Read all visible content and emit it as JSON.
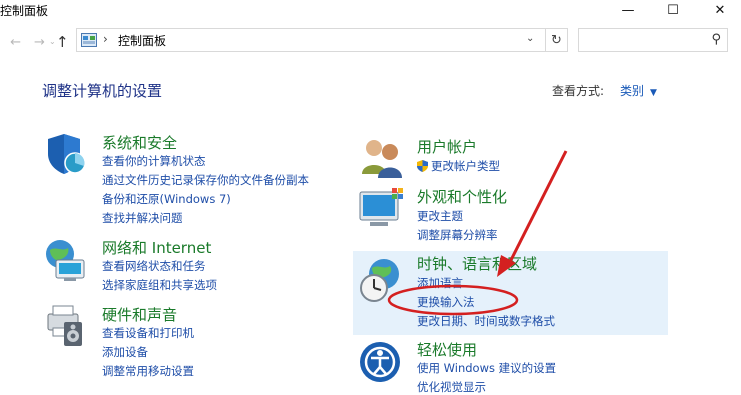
{
  "window": {
    "title": "控制面板",
    "min_icon": "—",
    "max_icon": "☐",
    "close_icon": "✕"
  },
  "nav": {
    "back": "→",
    "forward": "→",
    "up": "↑",
    "breadcrumb": "控制面板",
    "refresh": "↻",
    "search_placeholder": ""
  },
  "header": {
    "title": "调整计算机的设置",
    "view_by_label": "查看方式:",
    "view_by_value": "类别"
  },
  "categories": {
    "system": {
      "title": "系统和安全",
      "links": [
        "查看你的计算机状态",
        "通过文件历史记录保存你的文件备份副本",
        "备份和还原(Windows 7)",
        "查找并解决问题"
      ]
    },
    "network": {
      "title": "网络和 Internet",
      "links": [
        "查看网络状态和任务",
        "选择家庭组和共享选项"
      ]
    },
    "hardware": {
      "title": "硬件和声音",
      "links": [
        "查看设备和打印机",
        "添加设备",
        "调整常用移动设置"
      ]
    },
    "user": {
      "title": "用户帐户",
      "links": [
        "更改帐户类型"
      ]
    },
    "appearance": {
      "title": "外观和个性化",
      "links": [
        "更改主题",
        "调整屏幕分辨率"
      ]
    },
    "clock": {
      "title": "时钟、语言和区域",
      "links": [
        "添加语言",
        "更换输入法",
        "更改日期、时间或数字格式"
      ]
    },
    "ease": {
      "title": "轻松使用",
      "links": [
        "使用 Windows 建议的设置",
        "优化视觉显示"
      ]
    }
  },
  "colors": {
    "category_title": "#1a7a2a",
    "link": "#1f4ea8",
    "heading": "#1e3287",
    "highlight": "#e5f1fb",
    "annotation": "#d42020"
  }
}
